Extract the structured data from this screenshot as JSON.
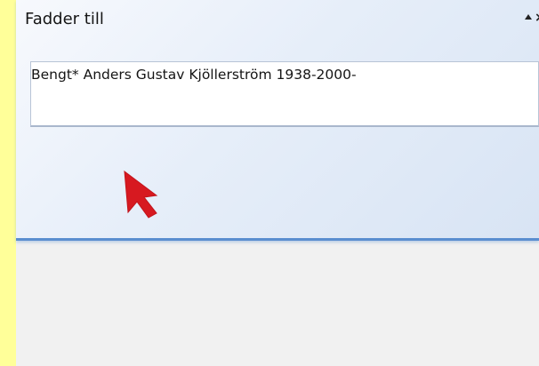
{
  "pane": {
    "title": "Fadder till",
    "controls": {
      "collapse_icon": "arrow-up-icon",
      "close_icon": "close-icon"
    },
    "value": "Bengt* Anders Gustav Kjöllerström 1938-2000-"
  },
  "cursor": {
    "icon": "mouse-pointer-icon",
    "color": "#d71920"
  },
  "colors": {
    "background": "#ffff99",
    "pane_accent": "#5a8ecf",
    "panel_background": "#f1f1f1"
  }
}
